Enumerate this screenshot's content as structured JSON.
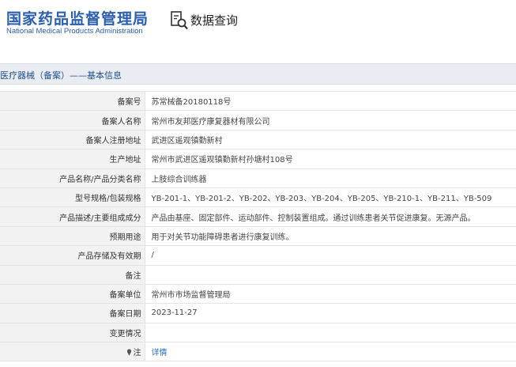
{
  "header": {
    "logo_cn": "国家药品监督管理局",
    "logo_en": "National Medical Products Administration",
    "query_label": "数据查询",
    "query_icon": "document-search-icon"
  },
  "section": {
    "title": "医疗器械（备案）——基本信息"
  },
  "rows": [
    {
      "label": "备案号",
      "value": "苏常械备20180118号"
    },
    {
      "label": "备案人名称",
      "value": "常州市友邦医疗康复器材有限公司"
    },
    {
      "label": "备案人注册地址",
      "value": "武进区遥观镇勤新村"
    },
    {
      "label": "生产地址",
      "value": "常州市武进区遥观镇勤新村孙塘村108号"
    },
    {
      "label": "产品名称/产品分类名称",
      "value": "上肢综合训练器"
    },
    {
      "label": "型号规格/包装规格",
      "value": "YB-201-1、YB-201-2、YB-202、YB-203、YB-204、YB-205、YB-210-1、YB-211、YB-509"
    },
    {
      "label": "产品描述/主要组成成分",
      "value": "产品由基座、固定部件、运动部件、控制装置组成。通过训练患者关节促进康复。无源产品。"
    },
    {
      "label": "预期用途",
      "value": "用于对关节功能障碍患者进行康复训练。"
    },
    {
      "label": "产品存储及有效期",
      "value": "/"
    },
    {
      "label": "备注",
      "value": ""
    },
    {
      "label": "备案单位",
      "value": "常州市市场监督管理局"
    },
    {
      "label": "备案日期",
      "value": "2023-11-27"
    },
    {
      "label": "变更情况",
      "value": ""
    },
    {
      "label": "注",
      "value": "详情",
      "icon": "pin-icon"
    }
  ],
  "colors": {
    "brand_blue": "#2b5fae",
    "section_bg": "#e9edf2",
    "label_bg": "#f2f2f2",
    "link": "#2b6cc4"
  }
}
